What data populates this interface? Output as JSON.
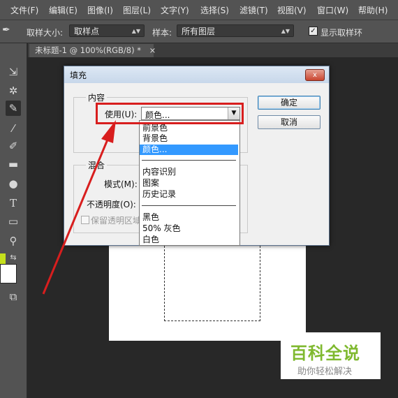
{
  "menubar": {
    "items": [
      "文件(F)",
      "编辑(E)",
      "图像(I)",
      "图层(L)",
      "文字(Y)",
      "选择(S)",
      "滤镜(T)",
      "视图(V)",
      "窗口(W)",
      "帮助(H)"
    ]
  },
  "options_bar": {
    "sample_size_label": "取样大小:",
    "sample_size_value": "取样点",
    "sample_label": "样本:",
    "sample_value": "所有图层",
    "show_ring_label": "显示取样环"
  },
  "document_tab": {
    "title": "未标题-1 @ 100%(RGB/8) *",
    "close": "×"
  },
  "tools": [
    "move-tool",
    "magic-wand-tool",
    "eyedropper-tool",
    "brush-tool",
    "history-brush-tool",
    "gradient-tool",
    "dodge-tool",
    "type-tool",
    "rectangle-tool",
    "zoom-tool",
    "swap-colors",
    "screen-mode"
  ],
  "colors": {
    "foreground": "#c5e01c",
    "background": "#ffffff",
    "highlight_red": "#d81e1e",
    "selection_blue": "#3399ff"
  },
  "dialog": {
    "title": "填充",
    "close": "x",
    "content_group": "内容",
    "use_label": "使用(U):",
    "use_value": "颜色...",
    "blend_group": "混合",
    "mode_label": "模式(M):",
    "opacity_label": "不透明度(O):",
    "preserve_label": "保留透明区域",
    "ok_button": "确定",
    "cancel_button": "取消"
  },
  "dropdown": {
    "options": [
      "前景色",
      "背景色",
      "颜色...",
      "内容识别",
      "图案",
      "历史记录",
      "黑色",
      "50% 灰色",
      "白色"
    ],
    "selected": "颜色..."
  },
  "watermark": {
    "title": "百科全说",
    "subtitle": "助你轻松解决"
  }
}
